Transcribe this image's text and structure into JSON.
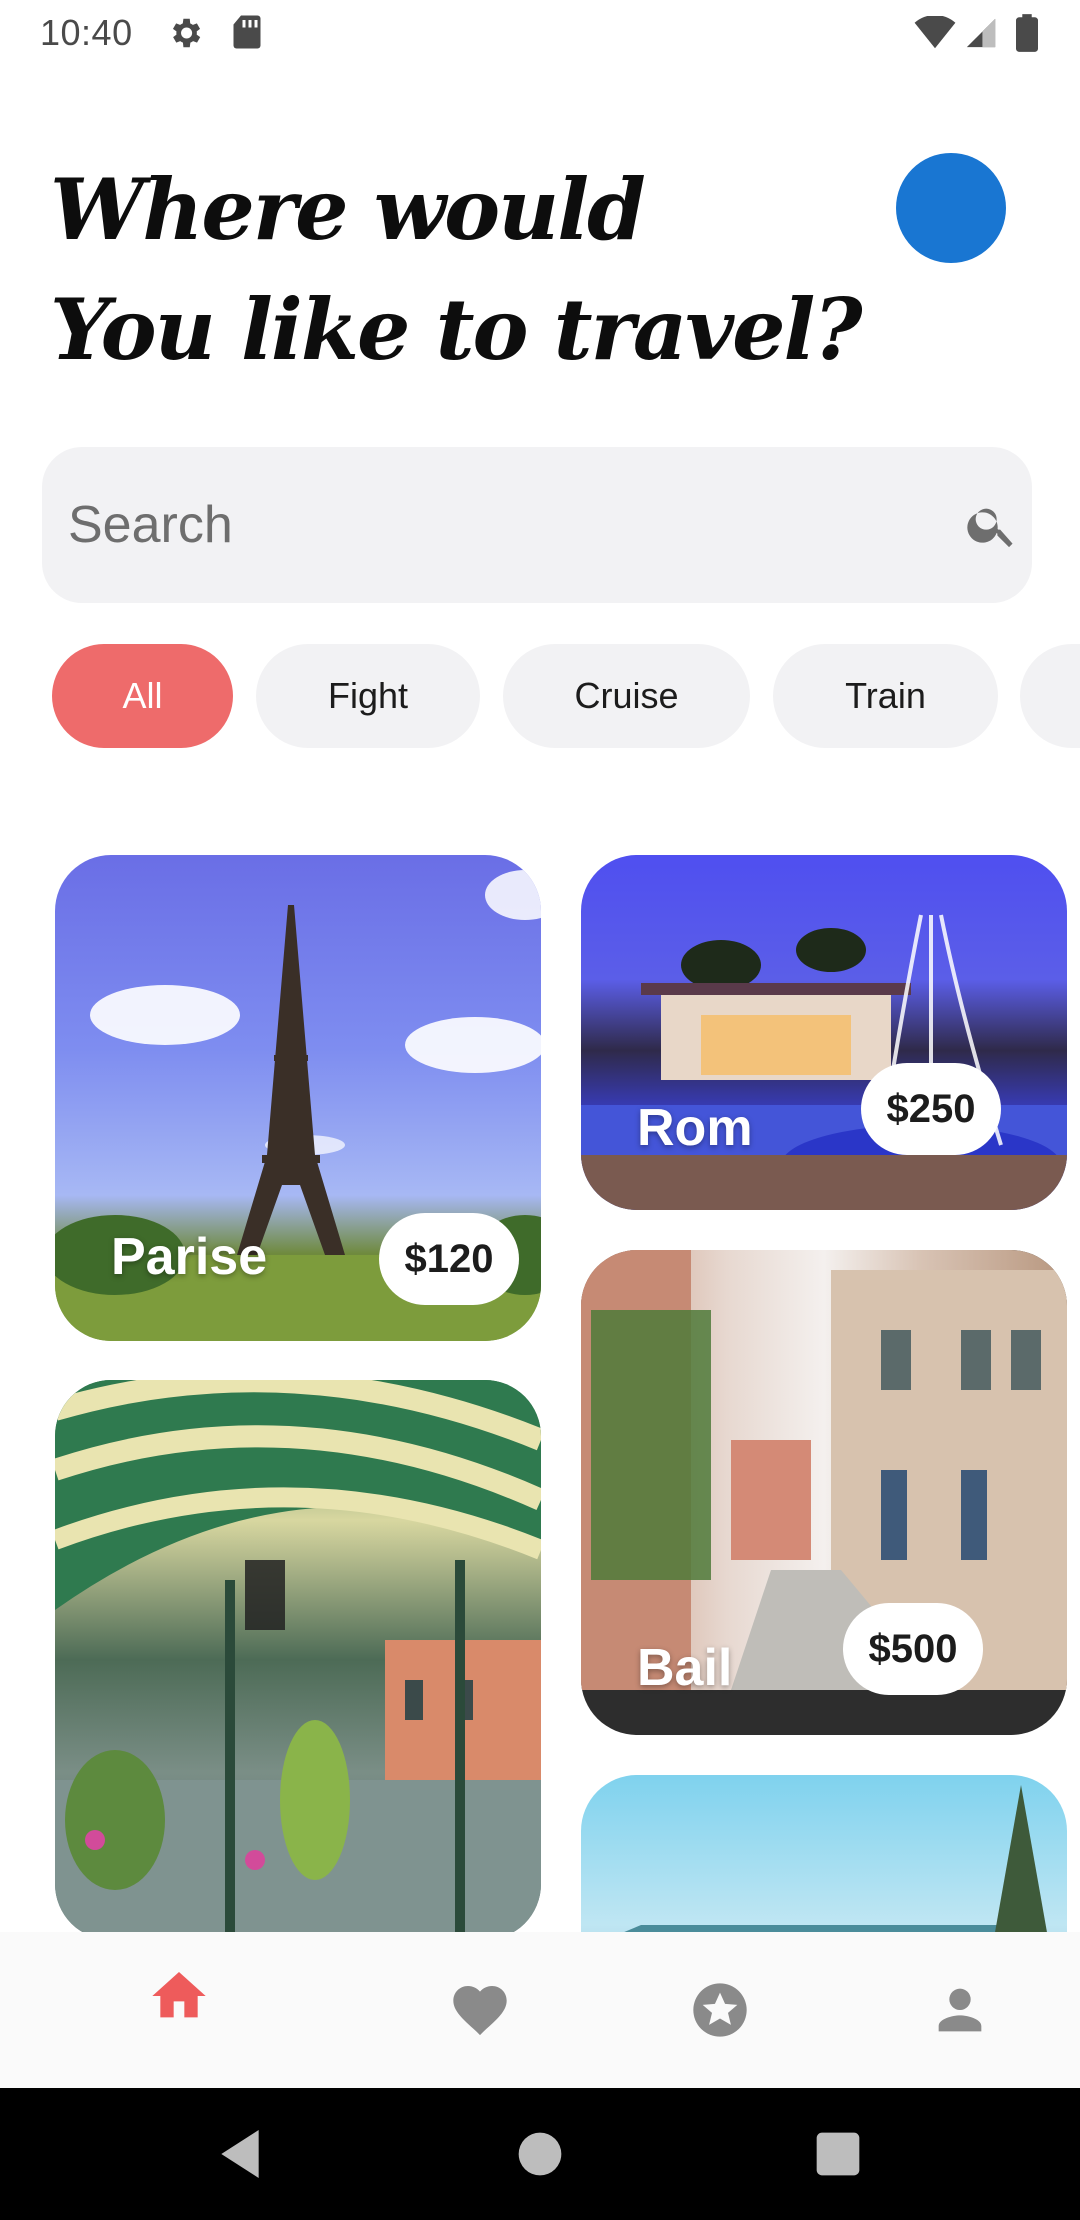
{
  "status_bar": {
    "time": "10:40",
    "icons": [
      "gear-icon",
      "sd-card-icon",
      "wifi-icon",
      "signal-icon",
      "battery-icon"
    ]
  },
  "header": {
    "title_line1": "Where would",
    "title_line2": "You like to travel?",
    "avatar_color": "#1976d2"
  },
  "search": {
    "placeholder": "Search",
    "icon": "search-icon"
  },
  "categories": {
    "items": [
      {
        "label": "All",
        "active": true
      },
      {
        "label": "Fight",
        "active": false
      },
      {
        "label": "Cruise",
        "active": false
      },
      {
        "label": "Train",
        "active": false
      },
      {
        "label": "",
        "active": false
      }
    ],
    "active_color": "#ee6b6b"
  },
  "destinations": [
    {
      "name": "Parise",
      "price": "$120"
    },
    {
      "name": "Rom",
      "price": "$250"
    },
    {
      "name": "Bail",
      "price": "$500"
    },
    {
      "name": "",
      "price": ""
    },
    {
      "name": "",
      "price": ""
    }
  ],
  "bottom_nav": {
    "items": [
      {
        "icon": "home-icon",
        "active": true
      },
      {
        "icon": "heart-icon",
        "active": false
      },
      {
        "icon": "star-icon",
        "active": false
      },
      {
        "icon": "person-icon",
        "active": false
      }
    ],
    "active_color": "#ee5b5b",
    "inactive_color": "#8a8a8a"
  },
  "system_nav": {
    "buttons": [
      "back-icon",
      "home-circle-icon",
      "recents-icon"
    ]
  }
}
